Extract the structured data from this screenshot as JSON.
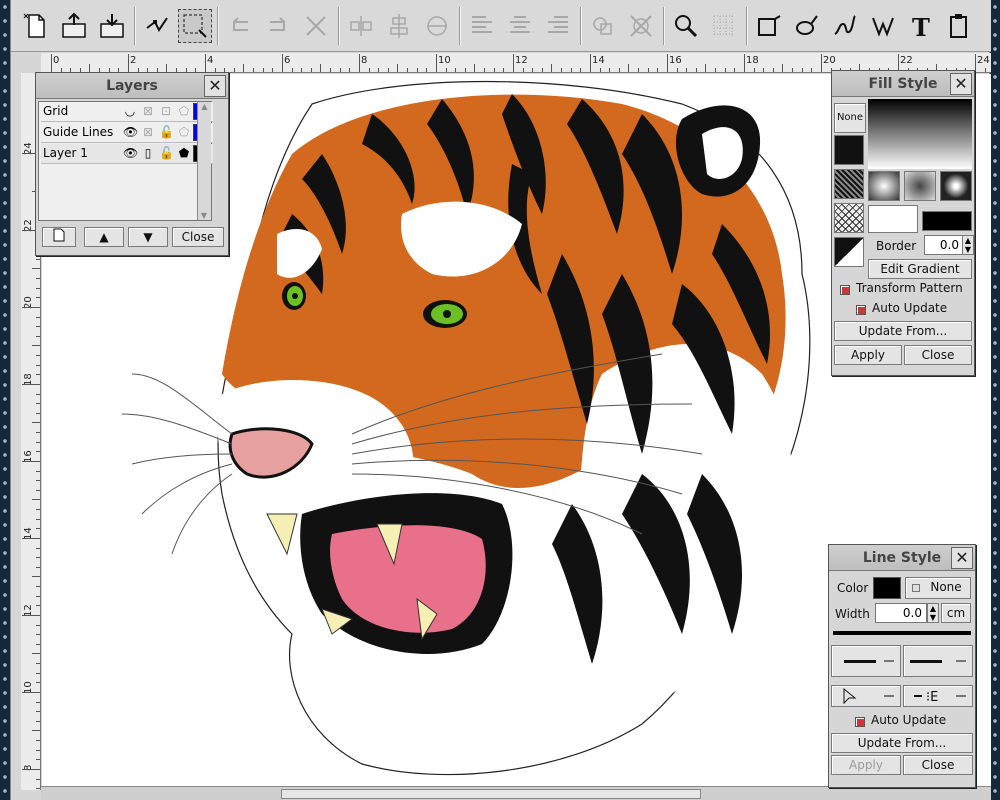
{
  "toolbar": {
    "tools": [
      "new-icon",
      "open-icon",
      "import-icon",
      "node-edit-icon",
      "select-rect-icon",
      "undo-icon",
      "redo-icon",
      "delete-icon",
      "align-icon",
      "align-center-icon",
      "align-vertical-icon",
      "distribute-icon",
      "distribute-center-icon",
      "distribute-right-icon",
      "group-icon",
      "ungroup-icon",
      "zoom-icon",
      "grid-icon",
      "rectangle-icon",
      "ellipse-icon",
      "freehand-icon",
      "bezier-icon",
      "text-icon",
      "clipboard-icon"
    ]
  },
  "rulers": {
    "horizontal": [
      "0",
      "2",
      "4",
      "6",
      "8",
      "10",
      "12",
      "14",
      "16",
      "18",
      "20",
      "22",
      "24"
    ],
    "vertical": [
      "24",
      "22",
      "20",
      "18",
      "16",
      "14",
      "12",
      "10",
      "8"
    ]
  },
  "layers_panel": {
    "title": "Layers",
    "close": "✕",
    "layers": [
      {
        "name": "Grid",
        "color": "#0000ff"
      },
      {
        "name": "Guide Lines",
        "color": "#0000ff"
      },
      {
        "name": "Layer 1",
        "color": "#000000"
      }
    ],
    "buttons": {
      "new": "",
      "up": "▲",
      "down": "▼",
      "close": "Close"
    }
  },
  "fill_panel": {
    "title": "Fill Style",
    "close": "✕",
    "none_label": "None",
    "border_label": "Border",
    "border_value": "0.0",
    "edit_gradient": "Edit Gradient",
    "transform_pattern": "Transform Pattern",
    "auto_update": "Auto Update",
    "update_from": "Update From...",
    "apply": "Apply",
    "close_btn": "Close"
  },
  "line_panel": {
    "title": "Line Style",
    "close": "✕",
    "color_label": "Color",
    "none_label": "None",
    "width_label": "Width",
    "width_value": "0.0",
    "unit": "cm",
    "auto_update": "Auto Update",
    "update_from": "Update From...",
    "apply": "Apply",
    "close_btn": "Close"
  },
  "colors": {
    "tiger_orange": "#d2691e",
    "eye_green": "#6cc024",
    "mouth_pink": "#e8708a",
    "nose_pink": "#e6a0a0",
    "fangs": "#f5efb5"
  }
}
